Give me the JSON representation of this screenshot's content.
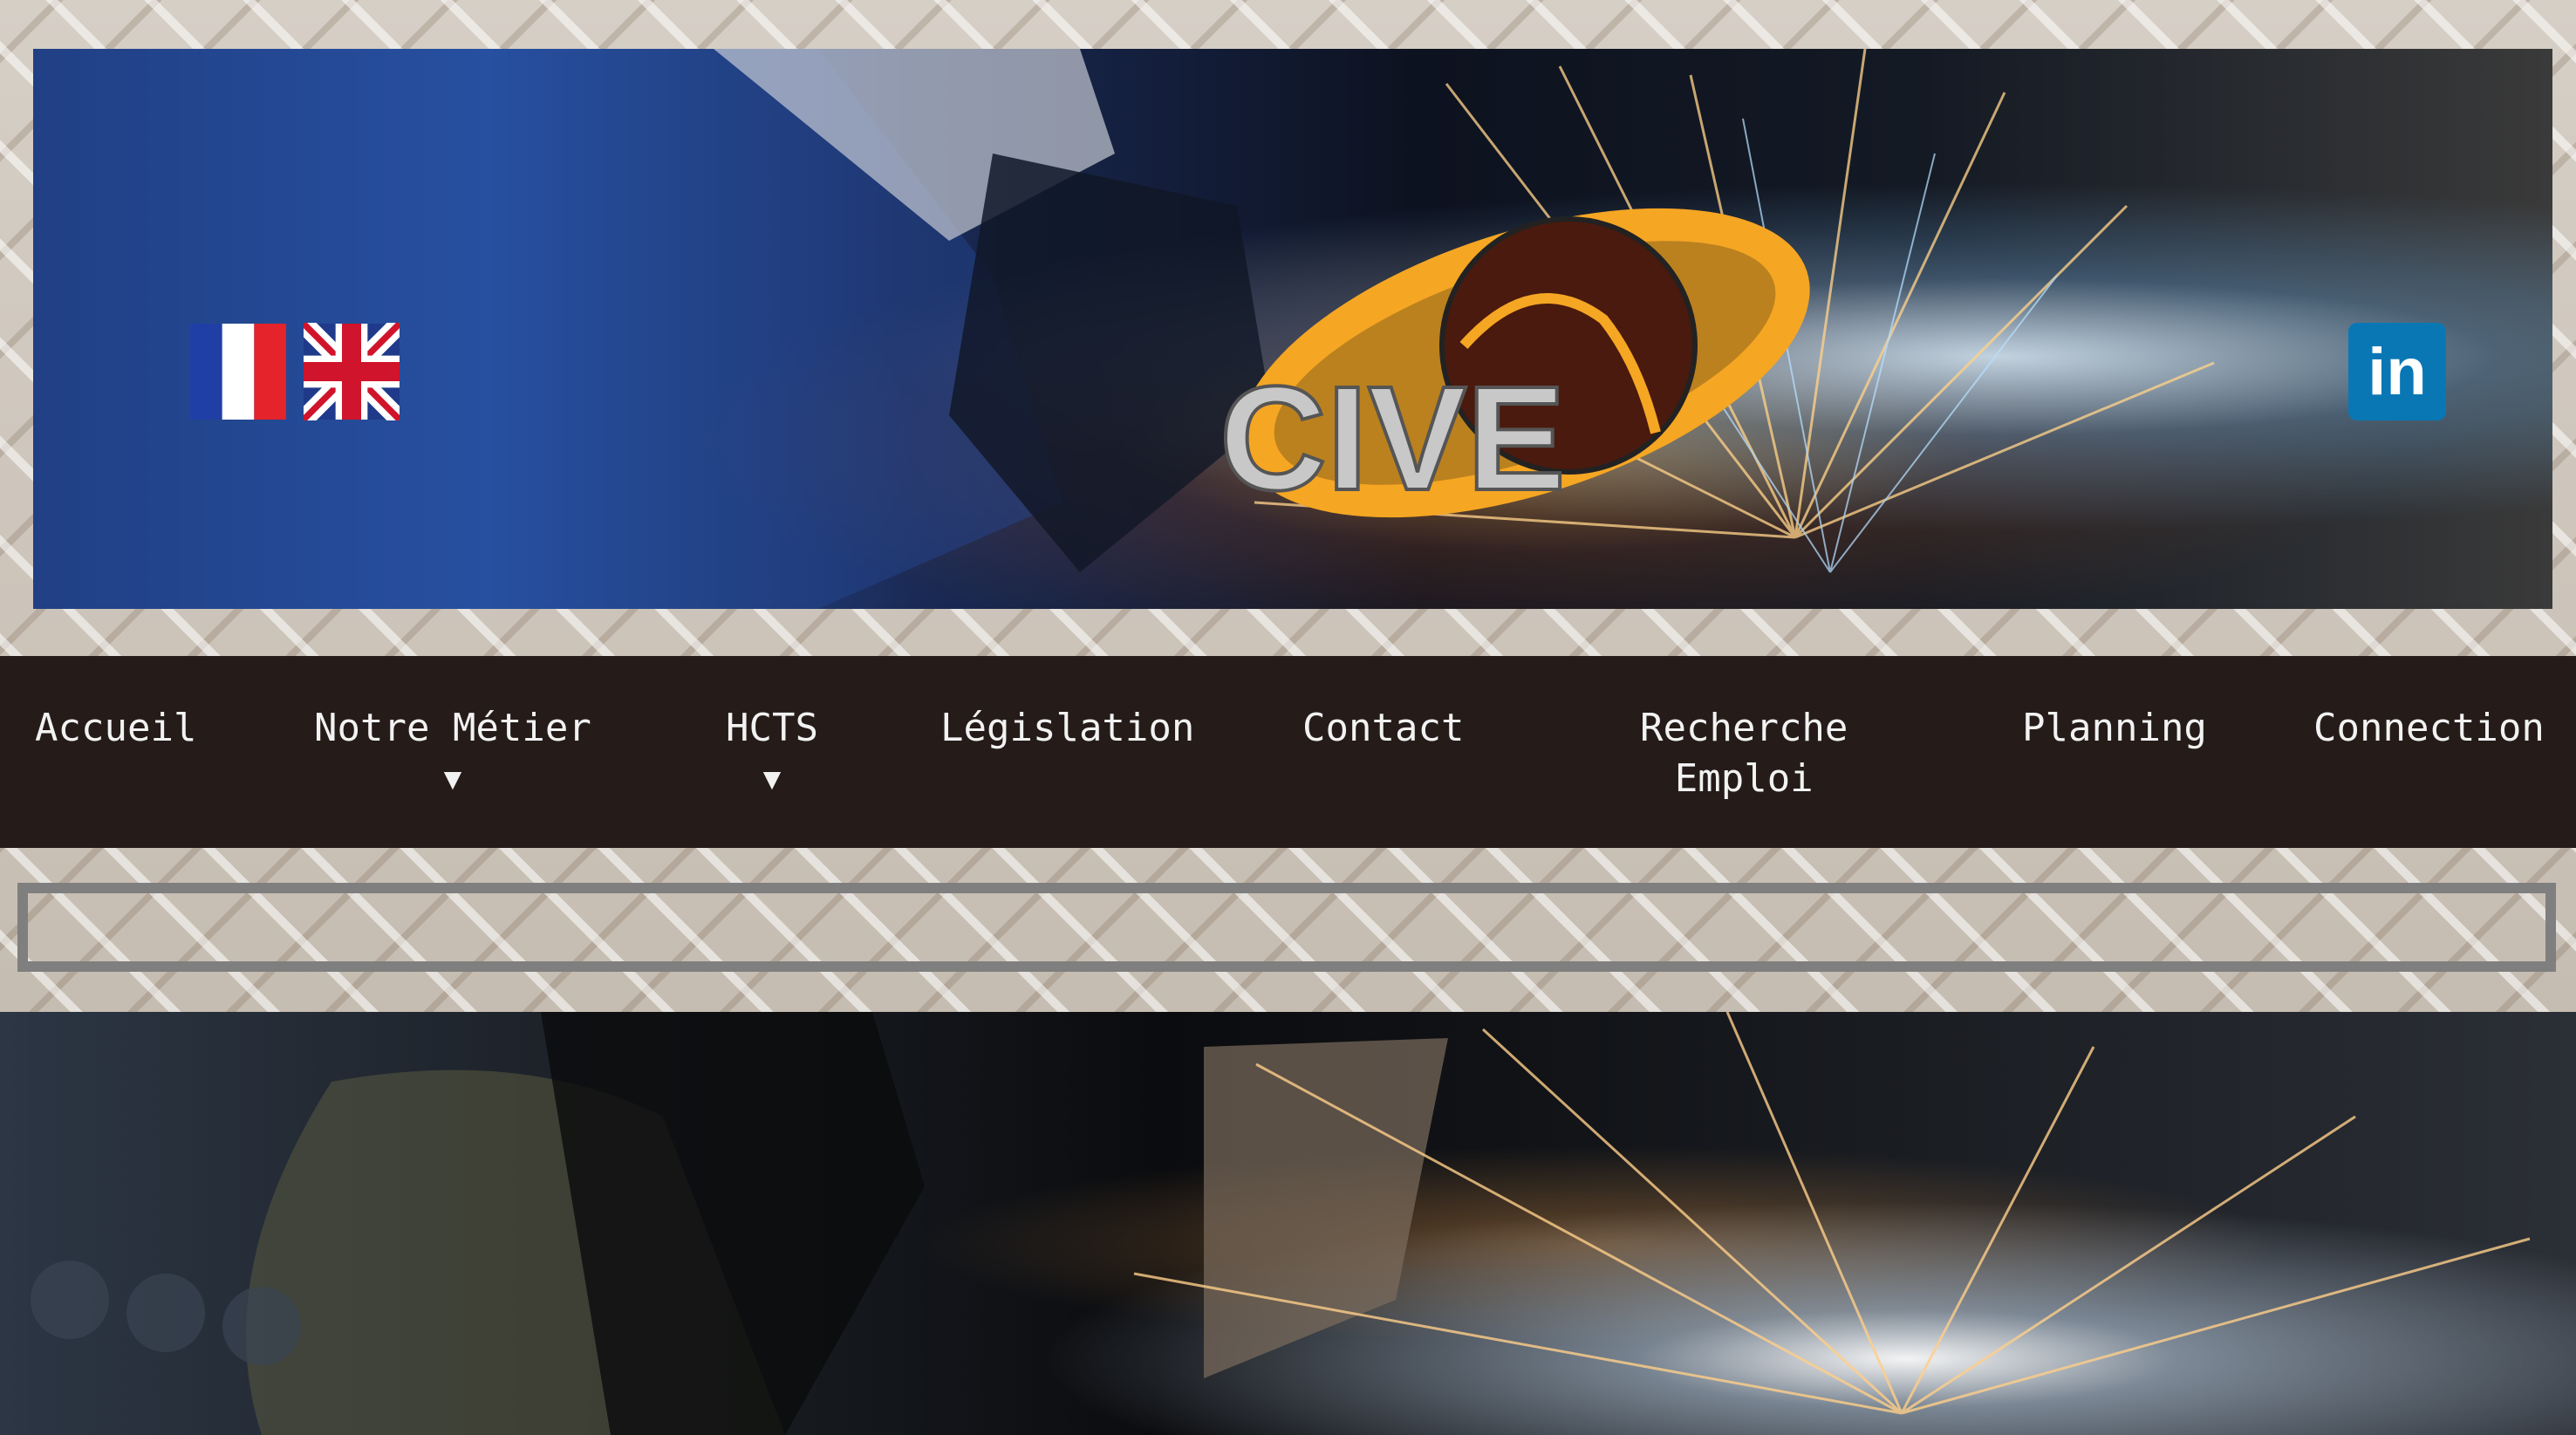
{
  "brand": {
    "logo_text": "CIVE",
    "accent_color": "#f5a623",
    "nav_background": "#251c19"
  },
  "header": {
    "languages": [
      {
        "name": "Français",
        "icon": "france-flag-icon"
      },
      {
        "name": "English",
        "icon": "uk-flag-icon"
      }
    ],
    "social": {
      "icon": "linkedin-icon",
      "label": "in"
    }
  },
  "nav": {
    "items": [
      {
        "label": "Accueil",
        "has_dropdown": false
      },
      {
        "label": "Notre Métier",
        "has_dropdown": true,
        "arrow": "▼"
      },
      {
        "label": "HCTS",
        "has_dropdown": true,
        "arrow": "▼"
      },
      {
        "label": "Législation",
        "has_dropdown": false
      },
      {
        "label": "Contact",
        "has_dropdown": false
      },
      {
        "label": "Recherche",
        "label2": "Emploi",
        "has_dropdown": false
      },
      {
        "label": "Planning",
        "has_dropdown": false
      },
      {
        "label": "Connection",
        "has_dropdown": false
      }
    ]
  }
}
